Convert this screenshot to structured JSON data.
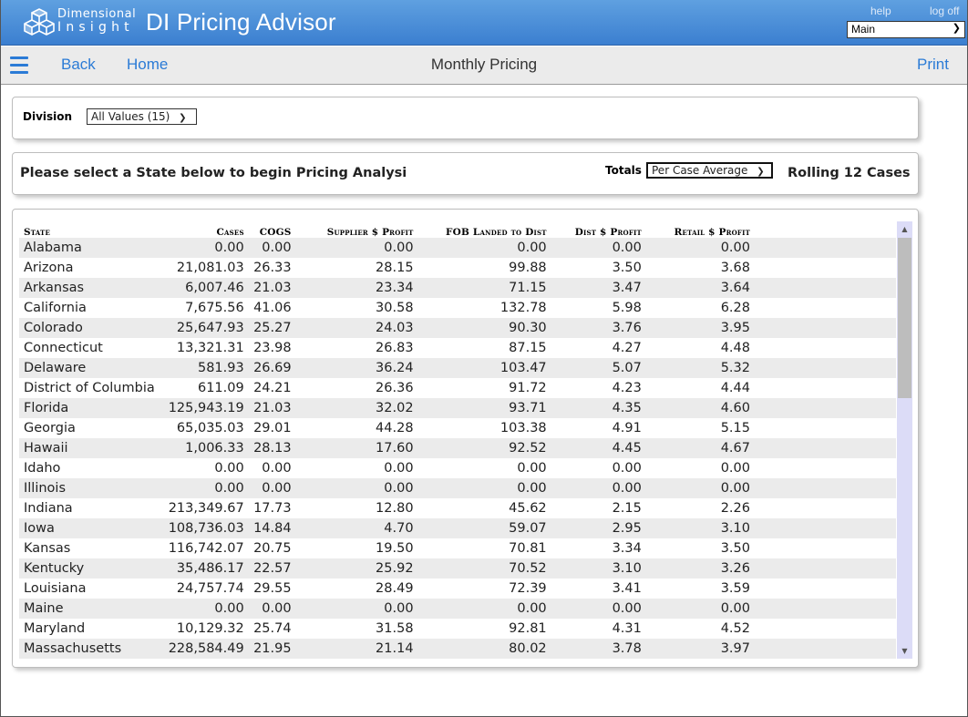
{
  "header": {
    "brand_line1": "Dimensional",
    "brand_line2": "Insight",
    "app_title": "DI Pricing Advisor",
    "help": "help",
    "logoff": "log off",
    "main_select": "Main"
  },
  "nav": {
    "back": "Back",
    "home": "Home",
    "title": "Monthly Pricing",
    "print": "Print"
  },
  "division": {
    "label": "Division",
    "value": "All Values (15)"
  },
  "prompt": {
    "text": "Please select a State below to begin Pricing Analysi",
    "totals_label": "Totals",
    "totals_value": "Per Case Average",
    "rolling": "Rolling 12 Cases"
  },
  "table": {
    "headers": {
      "state": "State",
      "cases": "Cases",
      "cogs": "COGS",
      "supplier_profit": "Supplier $ Profit",
      "fob": "FOB Landed to Dist",
      "dist_profit": "Dist $ Profit",
      "retail_profit": "Retail $ Profit"
    },
    "rows": [
      {
        "state": "Alabama",
        "cases": "0.00",
        "cogs": "0.00",
        "supplier_profit": "0.00",
        "fob": "0.00",
        "dist_profit": "0.00",
        "retail_profit": "0.00"
      },
      {
        "state": "Arizona",
        "cases": "21,081.03",
        "cogs": "26.33",
        "supplier_profit": "28.15",
        "fob": "99.88",
        "dist_profit": "3.50",
        "retail_profit": "3.68"
      },
      {
        "state": "Arkansas",
        "cases": "6,007.46",
        "cogs": "21.03",
        "supplier_profit": "23.34",
        "fob": "71.15",
        "dist_profit": "3.47",
        "retail_profit": "3.64"
      },
      {
        "state": "California",
        "cases": "7,675.56",
        "cogs": "41.06",
        "supplier_profit": "30.58",
        "fob": "132.78",
        "dist_profit": "5.98",
        "retail_profit": "6.28"
      },
      {
        "state": "Colorado",
        "cases": "25,647.93",
        "cogs": "25.27",
        "supplier_profit": "24.03",
        "fob": "90.30",
        "dist_profit": "3.76",
        "retail_profit": "3.95"
      },
      {
        "state": "Connecticut",
        "cases": "13,321.31",
        "cogs": "23.98",
        "supplier_profit": "26.83",
        "fob": "87.15",
        "dist_profit": "4.27",
        "retail_profit": "4.48"
      },
      {
        "state": "Delaware",
        "cases": "581.93",
        "cogs": "26.69",
        "supplier_profit": "36.24",
        "fob": "103.47",
        "dist_profit": "5.07",
        "retail_profit": "5.32"
      },
      {
        "state": "District of Columbia",
        "cases": "611.09",
        "cogs": "24.21",
        "supplier_profit": "26.36",
        "fob": "91.72",
        "dist_profit": "4.23",
        "retail_profit": "4.44"
      },
      {
        "state": "Florida",
        "cases": "125,943.19",
        "cogs": "21.03",
        "supplier_profit": "32.02",
        "fob": "93.71",
        "dist_profit": "4.35",
        "retail_profit": "4.60"
      },
      {
        "state": "Georgia",
        "cases": "65,035.03",
        "cogs": "29.01",
        "supplier_profit": "44.28",
        "fob": "103.38",
        "dist_profit": "4.91",
        "retail_profit": "5.15"
      },
      {
        "state": "Hawaii",
        "cases": "1,006.33",
        "cogs": "28.13",
        "supplier_profit": "17.60",
        "fob": "92.52",
        "dist_profit": "4.45",
        "retail_profit": "4.67"
      },
      {
        "state": "Idaho",
        "cases": "0.00",
        "cogs": "0.00",
        "supplier_profit": "0.00",
        "fob": "0.00",
        "dist_profit": "0.00",
        "retail_profit": "0.00"
      },
      {
        "state": "Illinois",
        "cases": "0.00",
        "cogs": "0.00",
        "supplier_profit": "0.00",
        "fob": "0.00",
        "dist_profit": "0.00",
        "retail_profit": "0.00"
      },
      {
        "state": "Indiana",
        "cases": "213,349.67",
        "cogs": "17.73",
        "supplier_profit": "12.80",
        "fob": "45.62",
        "dist_profit": "2.15",
        "retail_profit": "2.26"
      },
      {
        "state": "Iowa",
        "cases": "108,736.03",
        "cogs": "14.84",
        "supplier_profit": "4.70",
        "fob": "59.07",
        "dist_profit": "2.95",
        "retail_profit": "3.10"
      },
      {
        "state": "Kansas",
        "cases": "116,742.07",
        "cogs": "20.75",
        "supplier_profit": "19.50",
        "fob": "70.81",
        "dist_profit": "3.34",
        "retail_profit": "3.50"
      },
      {
        "state": "Kentucky",
        "cases": "35,486.17",
        "cogs": "22.57",
        "supplier_profit": "25.92",
        "fob": "70.52",
        "dist_profit": "3.10",
        "retail_profit": "3.26"
      },
      {
        "state": "Louisiana",
        "cases": "24,757.74",
        "cogs": "29.55",
        "supplier_profit": "28.49",
        "fob": "72.39",
        "dist_profit": "3.41",
        "retail_profit": "3.59"
      },
      {
        "state": "Maine",
        "cases": "0.00",
        "cogs": "0.00",
        "supplier_profit": "0.00",
        "fob": "0.00",
        "dist_profit": "0.00",
        "retail_profit": "0.00"
      },
      {
        "state": "Maryland",
        "cases": "10,129.32",
        "cogs": "25.74",
        "supplier_profit": "31.58",
        "fob": "92.81",
        "dist_profit": "4.31",
        "retail_profit": "4.52"
      },
      {
        "state": "Massachusetts",
        "cases": "228,584.49",
        "cogs": "21.95",
        "supplier_profit": "21.14",
        "fob": "80.02",
        "dist_profit": "3.78",
        "retail_profit": "3.97"
      }
    ]
  },
  "colors": {
    "header_top": "#5fa0e0",
    "header_bottom": "#3b7fd0",
    "link_blue": "#2b7bd6",
    "row_stripe": "#ebebeb",
    "scrollbar_track": "#dcdcf7"
  },
  "icons": {
    "logo": "dimensional-insight-cubes-logo",
    "menu": "hamburger-menu-icon",
    "dropdown": "chevron-down-icon"
  }
}
